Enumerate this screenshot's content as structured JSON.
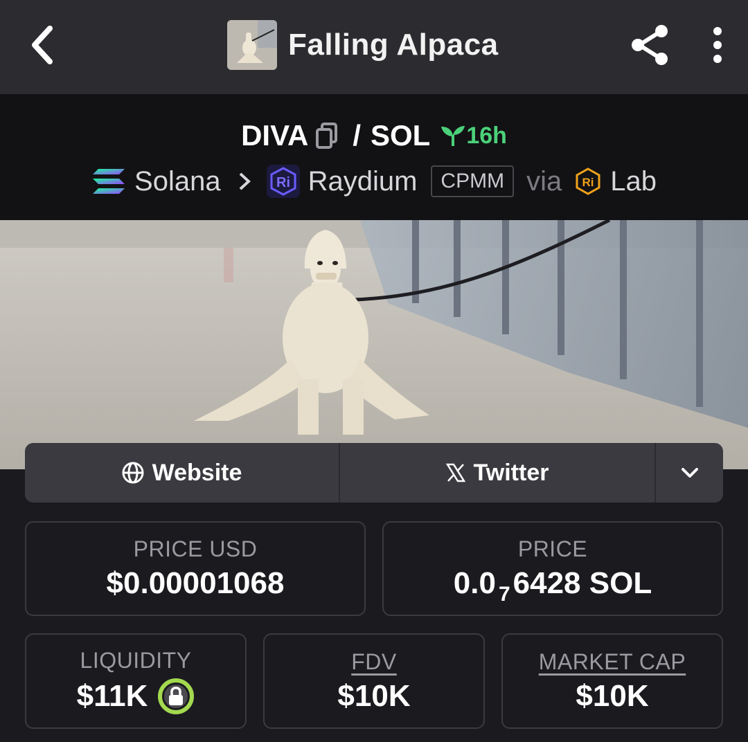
{
  "header": {
    "title": "Falling Alpaca",
    "back_icon": "chevron-left-icon",
    "share_icon": "share-icon",
    "more_icon": "more-vertical-icon"
  },
  "pair": {
    "base": "DIVA",
    "separator": "/",
    "quote": "SOL",
    "age": "16h",
    "age_color": "#4bd17a"
  },
  "chain": {
    "network": "Solana",
    "dex": "Raydium",
    "pool_type": "CPMM",
    "via_label": "via",
    "launchpad": "Lab"
  },
  "links": {
    "website": "Website",
    "twitter": "Twitter"
  },
  "stats": {
    "price_usd_label": "PRICE USD",
    "price_usd_value": "$0.00001068",
    "price_label": "PRICE",
    "price_prefix": "0.0",
    "price_zero_count": "7",
    "price_digits": "6428 SOL",
    "liquidity_label": "LIQUIDITY",
    "liquidity_value": "$11K",
    "fdv_label": "FDV",
    "fdv_value": "$10K",
    "mcap_label": "MARKET CAP",
    "mcap_value": "$10K"
  }
}
